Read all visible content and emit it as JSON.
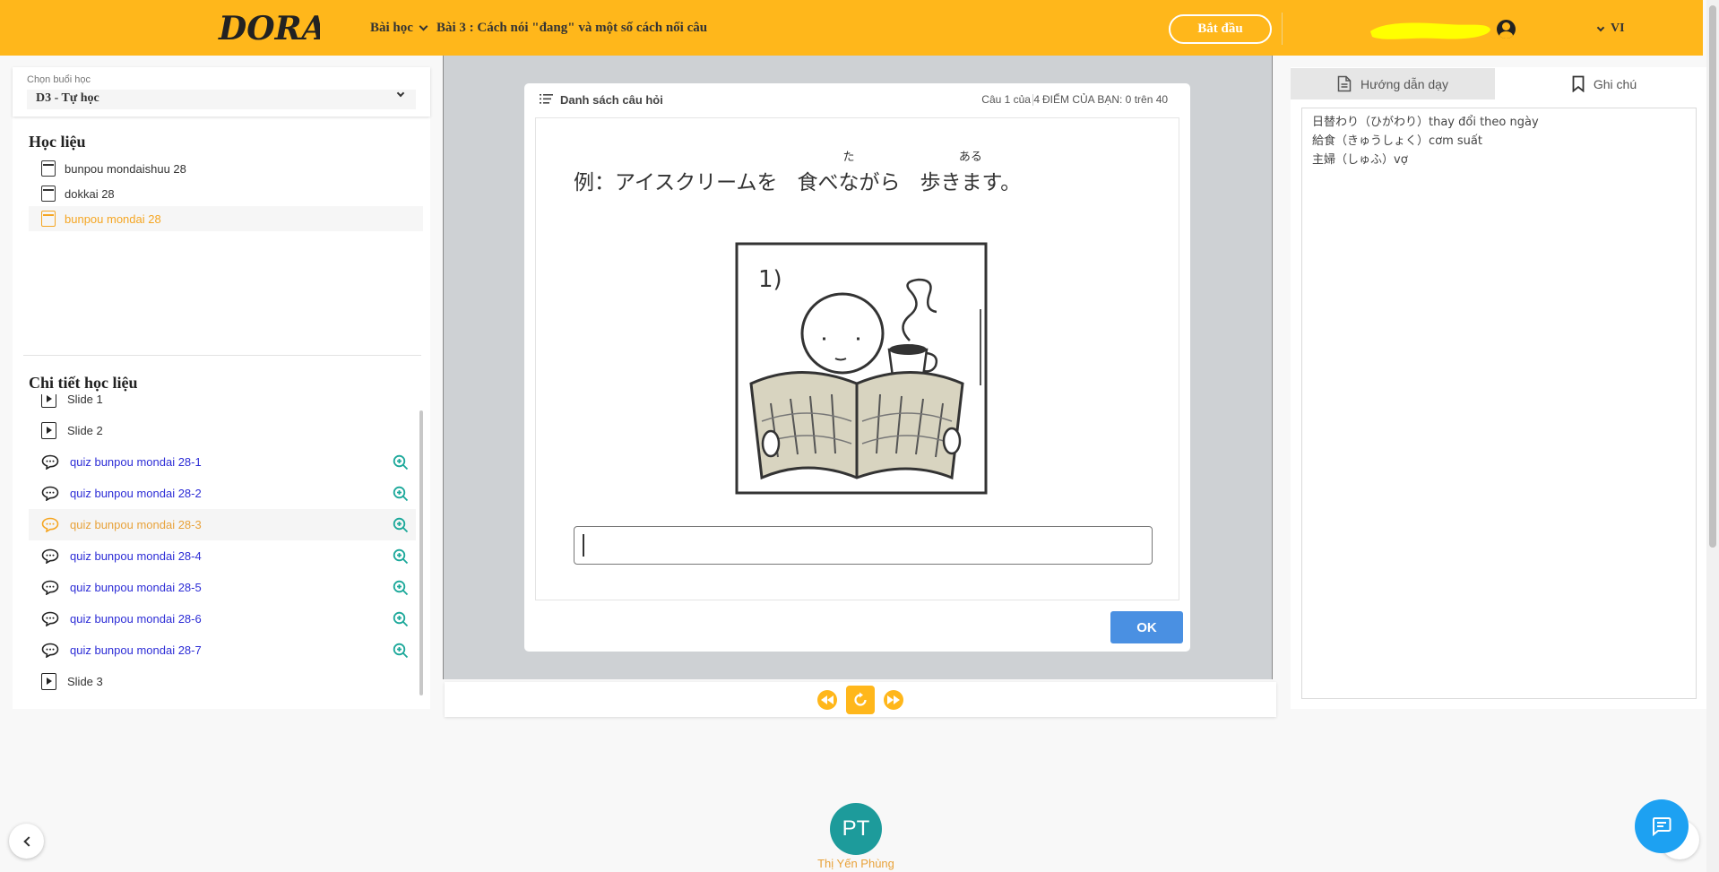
{
  "header": {
    "logo_text": "DORA",
    "lessons_menu": "Bài học",
    "lesson_title": "Bài 3 : Cách nói \"đang\" và một số cách nối câu",
    "start_button": "Bắt đầu",
    "language": "VI",
    "accent_color": "#ffb71b"
  },
  "session": {
    "label": "Chọn buổi học",
    "value": "D3 - Tự học"
  },
  "materials": {
    "title": "Học liệu",
    "items": [
      {
        "label": "bunpou mondaishuu 28",
        "icon": "book-icon",
        "active": false
      },
      {
        "label": "dokkai 28",
        "icon": "book-icon",
        "active": false
      },
      {
        "label": "bunpou mondai 28",
        "icon": "book-icon",
        "active": true
      }
    ]
  },
  "details": {
    "title": "Chi tiết học liệu",
    "items": [
      {
        "label": "Slide 1",
        "type": "slide"
      },
      {
        "label": "Slide 2",
        "type": "slide"
      },
      {
        "label": "quiz bunpou mondai 28-1",
        "type": "quiz"
      },
      {
        "label": "quiz bunpou mondai 28-2",
        "type": "quiz"
      },
      {
        "label": "quiz bunpou mondai 28-3",
        "type": "quiz",
        "active": true
      },
      {
        "label": "quiz bunpou mondai 28-4",
        "type": "quiz"
      },
      {
        "label": "quiz bunpou mondai 28-5",
        "type": "quiz"
      },
      {
        "label": "quiz bunpou mondai 28-6",
        "type": "quiz"
      },
      {
        "label": "quiz bunpou mondai 28-7",
        "type": "quiz"
      },
      {
        "label": "Slide 3",
        "type": "slide"
      }
    ]
  },
  "quiz": {
    "question_list_label": "Danh sách câu hỏi",
    "question_counter": "Câu 1 của 4",
    "score_label": "ĐIỂM CỦA BẠN: 0 trên 40",
    "sentence_prefix": "例：アイスクリームを",
    "word1_ruby": "た",
    "word1": "食べながら",
    "word2_ruby": "ある",
    "word2": "歩きます。",
    "image_label": "1)",
    "answer_value": "",
    "ok_button": "OK"
  },
  "player": {
    "prev_icon": "rewind-icon",
    "replay_icon": "replay-icon",
    "next_icon": "fast-forward-icon"
  },
  "right_panel": {
    "tab_guide": "Hướng dẫn dạy",
    "tab_notes": "Ghi chú",
    "notes": [
      "日替わり（ひがわり）thay đổi theo ngày",
      "給食（きゅうしょく）cơm suất",
      "主婦（しゅふ）vợ"
    ]
  },
  "user": {
    "avatar_initials": "PT",
    "name": "Thị Yến Phùng"
  }
}
